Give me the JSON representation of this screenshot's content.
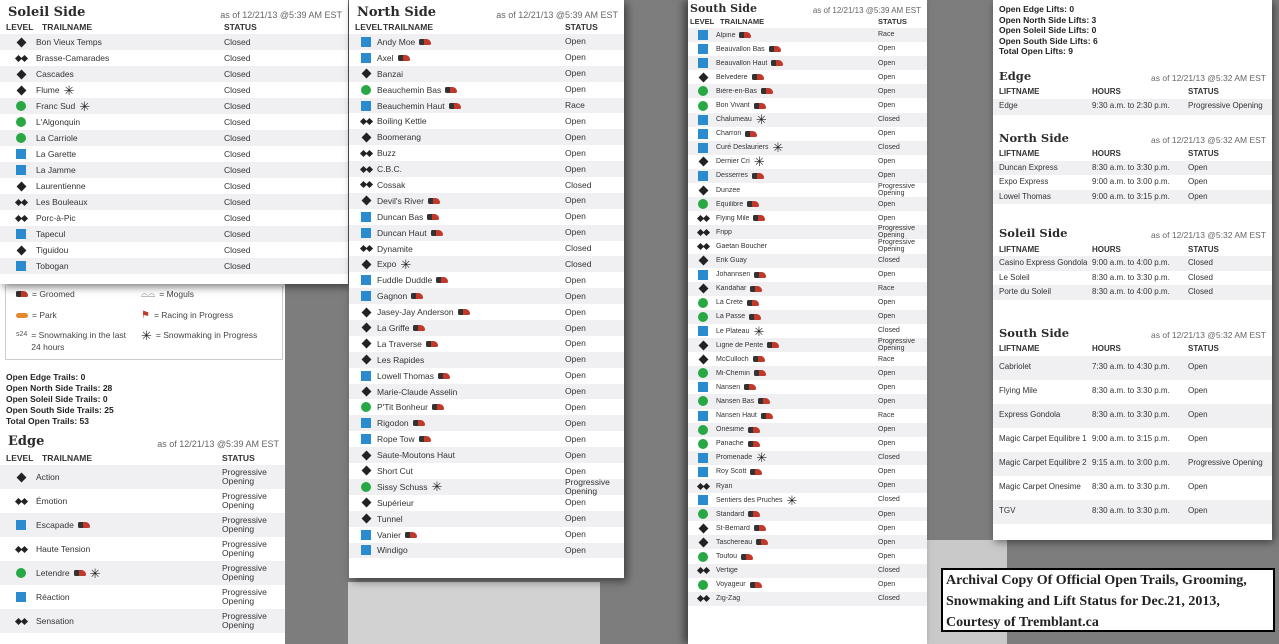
{
  "header": {
    "level": "LEVEL",
    "trailname": "TRAILNAME",
    "status": "STATUS",
    "liftname": "LIFTNAME",
    "hours": "HOURS"
  },
  "colors": {
    "green": "#27a844",
    "blue": "#2a8ccf",
    "black": "#222222"
  },
  "soleil": {
    "title": "Soleil Side",
    "date": "as of 12/21/13 @5:39 AM EST",
    "rows": [
      {
        "level": "diamond",
        "name": "Bon Vieux Temps",
        "icons": [],
        "status": "Closed"
      },
      {
        "level": "double",
        "name": "Brasse-Camarades",
        "icons": [],
        "status": "Closed"
      },
      {
        "level": "diamond",
        "name": "Cascades",
        "icons": [],
        "status": "Closed"
      },
      {
        "level": "diamond",
        "name": "Flume",
        "icons": [
          "snowmaking"
        ],
        "status": "Closed"
      },
      {
        "level": "circle",
        "name": "Franc Sud",
        "icons": [
          "snowmaking"
        ],
        "status": "Closed"
      },
      {
        "level": "circle",
        "name": "L'Algonquin",
        "icons": [],
        "status": "Closed"
      },
      {
        "level": "circle",
        "name": "La Carriole",
        "icons": [],
        "status": "Closed"
      },
      {
        "level": "square",
        "name": "La Garette",
        "icons": [],
        "status": "Closed"
      },
      {
        "level": "square",
        "name": "La Jamme",
        "icons": [],
        "status": "Closed"
      },
      {
        "level": "diamond",
        "name": "Laurentienne",
        "icons": [],
        "status": "Closed"
      },
      {
        "level": "double",
        "name": "Les Bouleaux",
        "icons": [],
        "status": "Closed"
      },
      {
        "level": "double",
        "name": "Porc-à-Pic",
        "icons": [],
        "status": "Closed"
      },
      {
        "level": "square",
        "name": "Tapecul",
        "icons": [],
        "status": "Closed"
      },
      {
        "level": "diamond",
        "name": "Tiguidou",
        "icons": [],
        "status": "Closed"
      },
      {
        "level": "square",
        "name": "Tobogan",
        "icons": [],
        "status": "Closed"
      }
    ]
  },
  "legend": {
    "groomed": "= Groomed",
    "moguls": "= Moguls",
    "park": "= Park",
    "racing": "= Racing in Progress",
    "snowmaking_24": "= Snowmaking in the last 24 hours",
    "snowmaking": "= Snowmaking in Progress",
    "badge": "s24"
  },
  "trail_counts": [
    "Open Edge Trails: 0",
    "Open North Side Trails: 28",
    "Open Soleil Side Trails: 0",
    "Open South Side Trails: 25",
    "Total Open Trails: 53"
  ],
  "edge": {
    "title": "Edge",
    "date": "as of 12/21/13 @5:39 AM EST",
    "rows": [
      {
        "level": "diamond",
        "name": "Action",
        "icons": [],
        "status": "Progressive Opening"
      },
      {
        "level": "double",
        "name": "Émotion",
        "icons": [],
        "status": "Progressive Opening"
      },
      {
        "level": "square",
        "name": "Escapade",
        "icons": [
          "groomed"
        ],
        "status": "Progressive Opening"
      },
      {
        "level": "double",
        "name": "Haute Tension",
        "icons": [],
        "status": "Progressive Opening"
      },
      {
        "level": "circle",
        "name": "Letendre",
        "icons": [
          "groomed",
          "snowmaking"
        ],
        "status": "Progressive Opening"
      },
      {
        "level": "square",
        "name": "Réaction",
        "icons": [],
        "status": "Progressive Opening"
      },
      {
        "level": "double",
        "name": "Sensation",
        "icons": [],
        "status": "Progressive Opening"
      }
    ]
  },
  "north": {
    "title": "North Side",
    "date": "as of 12/21/13 @5:39 AM EST",
    "rows": [
      {
        "level": "square",
        "name": "Andy Moe",
        "icons": [
          "groomed"
        ],
        "status": "Open"
      },
      {
        "level": "square",
        "name": "Axel",
        "icons": [
          "groomed"
        ],
        "status": "Open"
      },
      {
        "level": "diamond",
        "name": "Banzai",
        "icons": [],
        "status": "Open"
      },
      {
        "level": "circle",
        "name": "Beauchemin Bas",
        "icons": [
          "groomed"
        ],
        "status": "Open"
      },
      {
        "level": "square",
        "name": "Beauchemin Haut",
        "icons": [
          "groomed"
        ],
        "status": "Race"
      },
      {
        "level": "double",
        "name": "Boiling Kettle",
        "icons": [],
        "status": "Open"
      },
      {
        "level": "diamond",
        "name": "Boomerang",
        "icons": [],
        "status": "Open"
      },
      {
        "level": "double",
        "name": "Buzz",
        "icons": [],
        "status": "Open"
      },
      {
        "level": "double",
        "name": "C.B.C.",
        "icons": [],
        "status": "Open"
      },
      {
        "level": "double",
        "name": "Cossak",
        "icons": [],
        "status": "Closed"
      },
      {
        "level": "diamond",
        "name": "Devil's River",
        "icons": [
          "groomed"
        ],
        "status": "Open"
      },
      {
        "level": "square",
        "name": "Duncan Bas",
        "icons": [
          "groomed"
        ],
        "status": "Open"
      },
      {
        "level": "square",
        "name": "Duncan Haut",
        "icons": [
          "groomed"
        ],
        "status": "Open"
      },
      {
        "level": "double",
        "name": "Dynamite",
        "icons": [],
        "status": "Closed"
      },
      {
        "level": "diamond",
        "name": "Expo",
        "icons": [
          "snowmaking"
        ],
        "status": "Closed"
      },
      {
        "level": "square",
        "name": "Fuddle Duddle",
        "icons": [
          "groomed"
        ],
        "status": "Open"
      },
      {
        "level": "square",
        "name": "Gagnon",
        "icons": [
          "groomed"
        ],
        "status": "Open"
      },
      {
        "level": "diamond",
        "name": "Jasey-Jay Anderson",
        "icons": [
          "groomed"
        ],
        "status": "Open"
      },
      {
        "level": "diamond",
        "name": "La Griffe",
        "icons": [
          "groomed"
        ],
        "status": "Open"
      },
      {
        "level": "diamond",
        "name": "La Traverse",
        "icons": [
          "groomed"
        ],
        "status": "Open"
      },
      {
        "level": "diamond",
        "name": "Les Rapides",
        "icons": [],
        "status": "Open"
      },
      {
        "level": "square",
        "name": "Lowell Thomas",
        "icons": [
          "groomed"
        ],
        "status": "Open"
      },
      {
        "level": "diamond",
        "name": "Marie-Claude Asselin",
        "icons": [],
        "status": "Open"
      },
      {
        "level": "circle",
        "name": "P'Tit Bonheur",
        "icons": [
          "groomed"
        ],
        "status": "Open"
      },
      {
        "level": "square",
        "name": "Rigodon",
        "icons": [
          "groomed"
        ],
        "status": "Open"
      },
      {
        "level": "square",
        "name": "Rope Tow",
        "icons": [
          "groomed"
        ],
        "status": "Open"
      },
      {
        "level": "diamond",
        "name": "Saute-Moutons Haut",
        "icons": [],
        "status": "Open"
      },
      {
        "level": "diamond",
        "name": "Short Cut",
        "icons": [],
        "status": "Open"
      },
      {
        "level": "circle",
        "name": "Sissy Schuss",
        "icons": [
          "snowmaking"
        ],
        "status": "Progressive Opening"
      },
      {
        "level": "diamond",
        "name": "Supérieur",
        "icons": [],
        "status": "Open"
      },
      {
        "level": "diamond",
        "name": "Tunnel",
        "icons": [],
        "status": "Open"
      },
      {
        "level": "square",
        "name": "Vanier",
        "icons": [
          "groomed"
        ],
        "status": "Open"
      },
      {
        "level": "square",
        "name": "Windigo",
        "icons": [],
        "status": "Open"
      }
    ]
  },
  "south": {
    "title": "South Side",
    "date": "as of 12/21/13 @5:39 AM EST",
    "rows": [
      {
        "level": "square",
        "name": "Alpine",
        "icons": [
          "groomed"
        ],
        "status": "Race"
      },
      {
        "level": "square",
        "name": "Beauvallon Bas",
        "icons": [
          "groomed"
        ],
        "status": "Open"
      },
      {
        "level": "square",
        "name": "Beauvallon Haut",
        "icons": [
          "groomed"
        ],
        "status": "Open"
      },
      {
        "level": "diamond",
        "name": "Belvedere",
        "icons": [
          "groomed"
        ],
        "status": "Open"
      },
      {
        "level": "circle",
        "name": "Bière-en-Bas",
        "icons": [
          "groomed"
        ],
        "status": "Open"
      },
      {
        "level": "circle",
        "name": "Bon Vivant",
        "icons": [
          "groomed"
        ],
        "status": "Open"
      },
      {
        "level": "square",
        "name": "Chalumeau",
        "icons": [
          "snowmaking"
        ],
        "status": "Closed"
      },
      {
        "level": "square",
        "name": "Charron",
        "icons": [
          "groomed"
        ],
        "status": "Open"
      },
      {
        "level": "square",
        "name": "Curé Deslauriers",
        "icons": [
          "snowmaking"
        ],
        "status": "Closed"
      },
      {
        "level": "diamond",
        "name": "Dernier Cri",
        "icons": [
          "snowmaking"
        ],
        "status": "Open"
      },
      {
        "level": "square",
        "name": "Desserres",
        "icons": [
          "groomed"
        ],
        "status": "Open"
      },
      {
        "level": "diamond",
        "name": "Dunzee",
        "icons": [],
        "status": "Progressive Opening"
      },
      {
        "level": "circle",
        "name": "Équilibre",
        "icons": [
          "groomed"
        ],
        "status": "Open"
      },
      {
        "level": "double",
        "name": "Flying Mile",
        "icons": [
          "groomed"
        ],
        "status": "Open"
      },
      {
        "level": "double",
        "name": "Fripp",
        "icons": [],
        "status": "Progressive Opening"
      },
      {
        "level": "double",
        "name": "Gaetan Boucher",
        "icons": [],
        "status": "Progressive Opening"
      },
      {
        "level": "diamond",
        "name": "Erik Guay",
        "icons": [],
        "status": "Closed"
      },
      {
        "level": "square",
        "name": "Johannsen",
        "icons": [
          "groomed"
        ],
        "status": "Open"
      },
      {
        "level": "diamond",
        "name": "Kandahar",
        "icons": [
          "groomed"
        ],
        "status": "Race"
      },
      {
        "level": "circle",
        "name": "La Crete",
        "icons": [
          "groomed"
        ],
        "status": "Open"
      },
      {
        "level": "circle",
        "name": "La Passe",
        "icons": [
          "groomed"
        ],
        "status": "Open"
      },
      {
        "level": "square",
        "name": "Le Plateau",
        "icons": [
          "snowmaking"
        ],
        "status": "Closed"
      },
      {
        "level": "diamond",
        "name": "Ligne de Pente",
        "icons": [
          "groomed"
        ],
        "status": "Progressive Opening"
      },
      {
        "level": "diamond",
        "name": "McCulloch",
        "icons": [
          "groomed"
        ],
        "status": "Race"
      },
      {
        "level": "circle",
        "name": "Mi-Chemin",
        "icons": [
          "groomed"
        ],
        "status": "Open"
      },
      {
        "level": "square",
        "name": "Nansen",
        "icons": [
          "groomed"
        ],
        "status": "Open"
      },
      {
        "level": "circle",
        "name": "Nansen Bas",
        "icons": [
          "groomed"
        ],
        "status": "Open"
      },
      {
        "level": "square",
        "name": "Nansen Haut",
        "icons": [
          "groomed"
        ],
        "status": "Race"
      },
      {
        "level": "circle",
        "name": "Onésime",
        "icons": [
          "groomed"
        ],
        "status": "Open"
      },
      {
        "level": "circle",
        "name": "Panache",
        "icons": [
          "groomed"
        ],
        "status": "Open"
      },
      {
        "level": "square",
        "name": "Promenade",
        "icons": [
          "snowmaking"
        ],
        "status": "Closed"
      },
      {
        "level": "square",
        "name": "Roy Scott",
        "icons": [
          "groomed"
        ],
        "status": "Open"
      },
      {
        "level": "double",
        "name": "Ryan",
        "icons": [],
        "status": "Open"
      },
      {
        "level": "square",
        "name": "Sentiers des Pruches",
        "icons": [
          "snowmaking"
        ],
        "status": "Closed"
      },
      {
        "level": "circle",
        "name": "Standard",
        "icons": [
          "groomed"
        ],
        "status": "Open"
      },
      {
        "level": "diamond",
        "name": "St-Bernard",
        "icons": [
          "groomed"
        ],
        "status": "Open"
      },
      {
        "level": "diamond",
        "name": "Taschereau",
        "icons": [
          "groomed"
        ],
        "status": "Open"
      },
      {
        "level": "circle",
        "name": "Toufou",
        "icons": [
          "groomed"
        ],
        "status": "Open"
      },
      {
        "level": "double",
        "name": "Vertige",
        "icons": [],
        "status": "Closed"
      },
      {
        "level": "circle",
        "name": "Voyageur",
        "icons": [
          "groomed"
        ],
        "status": "Open"
      },
      {
        "level": "double",
        "name": "Zig-Zag",
        "icons": [],
        "status": "Closed"
      }
    ]
  },
  "lift_counts": [
    "Open Edge Lifts: 0",
    "Open North Side Lifts: 3",
    "Open Soleil Side Lifts: 0",
    "Open South Side Lifts: 6",
    "Total Open Lifts: 9"
  ],
  "lifts": [
    {
      "title": "Edge",
      "date": "as of 12/21/13 @5:32 AM EST",
      "rows": [
        {
          "name": "Edge",
          "hours": "9:30 a.m. to 2:30 p.m.",
          "status": "Progressive Opening"
        }
      ]
    },
    {
      "title": "North Side",
      "date": "as of 12/21/13 @5:32 AM EST",
      "rows": [
        {
          "name": "Duncan Express",
          "hours": "8:30 a.m. to 3:30 p.m.",
          "status": "Open"
        },
        {
          "name": "Expo Express",
          "hours": "9:00 a.m. to 3:00 p.m.",
          "status": "Open"
        },
        {
          "name": "Lowel Thomas",
          "hours": "9:00 a.m. to 3:15 p.m.",
          "status": "Open"
        }
      ]
    },
    {
      "title": "Soleil Side",
      "date": "as of 12/21/13 @5:32 AM EST",
      "rows": [
        {
          "name": "Casino Express Gondola",
          "hours": "9:00 a.m. to 4:00 p.m.",
          "status": "Closed"
        },
        {
          "name": "Le Soleil",
          "hours": "8:30 a.m. to 3:30 p.m.",
          "status": "Closed"
        },
        {
          "name": "Porte du Soleil",
          "hours": "8:30 a.m. to 4:00 p.m.",
          "status": "Closed"
        }
      ]
    },
    {
      "title": "South Side",
      "date": "as of 12/21/13 @5:32 AM EST",
      "rows": [
        {
          "name": "Cabriolet",
          "hours": "7:30 a.m. to 4:30 p.m.",
          "status": "Open"
        },
        {
          "name": "Flying Mile",
          "hours": "8:30 a.m. to 3:30 p.m.",
          "status": "Open"
        },
        {
          "name": "Express Gondola",
          "hours": "8:30 a.m. to 3:30 p.m.",
          "status": "Open"
        },
        {
          "name": "Magic Carpet Equilibre 1",
          "hours": "9:00 a.m. to 3:15 p.m.",
          "status": "Open"
        },
        {
          "name": "Magic Carpet Equilibre 2",
          "hours": "9:15 a.m. to 3:00 p.m.",
          "status": "Progressive Opening"
        },
        {
          "name": "Magic Carpet Onesime",
          "hours": "8:30 a.m. to 3:30 p.m.",
          "status": "Open"
        },
        {
          "name": "TGV",
          "hours": "8:30 a.m. to 3:30 p.m.",
          "status": "Open"
        }
      ]
    }
  ],
  "caption": [
    "Archival Copy Of Official Open Trails, Grooming,",
    "Snowmaking and Lift Status for Dec.21, 2013,",
    "Courtesy of Tremblant.ca"
  ]
}
